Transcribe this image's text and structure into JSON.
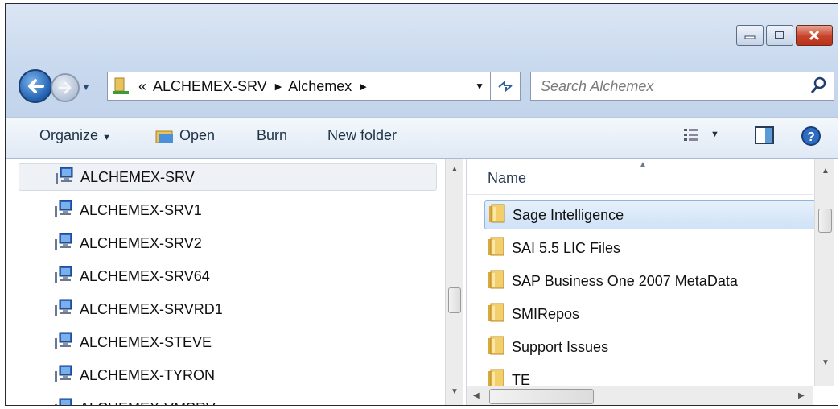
{
  "address_bar": {
    "overflow": "«",
    "crumbs": [
      "ALCHEMEX-SRV",
      "Alchemex"
    ]
  },
  "search": {
    "placeholder": "Search Alchemex"
  },
  "toolbar": {
    "organize_label": "Organize",
    "open_label": "Open",
    "burn_label": "Burn",
    "new_folder_label": "New folder"
  },
  "nav_tree": {
    "items": [
      {
        "label": "ALCHEMEX-SRV",
        "icon": "computer-icon",
        "selected": true
      },
      {
        "label": "ALCHEMEX-SRV1",
        "icon": "computer-icon"
      },
      {
        "label": "ALCHEMEX-SRV2",
        "icon": "computer-icon"
      },
      {
        "label": "ALCHEMEX-SRV64",
        "icon": "computer-icon"
      },
      {
        "label": "ALCHEMEX-SRVRD1",
        "icon": "computer-icon"
      },
      {
        "label": "ALCHEMEX-STEVE",
        "icon": "computer-icon"
      },
      {
        "label": "ALCHEMEX-TYRON",
        "icon": "computer-icon"
      },
      {
        "label": "ALCHEMEX-VMSRV",
        "icon": "computer-icon"
      }
    ]
  },
  "file_list": {
    "column_header": "Name",
    "items": [
      {
        "label": "Sage Intelligence",
        "icon": "folder-icon",
        "selected": true
      },
      {
        "label": "SAI 5.5 LIC Files",
        "icon": "folder-icon"
      },
      {
        "label": "SAP Business One 2007 MetaData",
        "icon": "folder-icon"
      },
      {
        "label": "SMIRepos",
        "icon": "folder-icon"
      },
      {
        "label": "Support Issues",
        "icon": "folder-icon"
      },
      {
        "label": "TE",
        "icon": "folder-icon"
      }
    ]
  },
  "colors": {
    "chrome": "#c9d9ee",
    "close_button": "#c7432a",
    "selection": "#cfe2f7",
    "folder": "#e8c25a"
  }
}
